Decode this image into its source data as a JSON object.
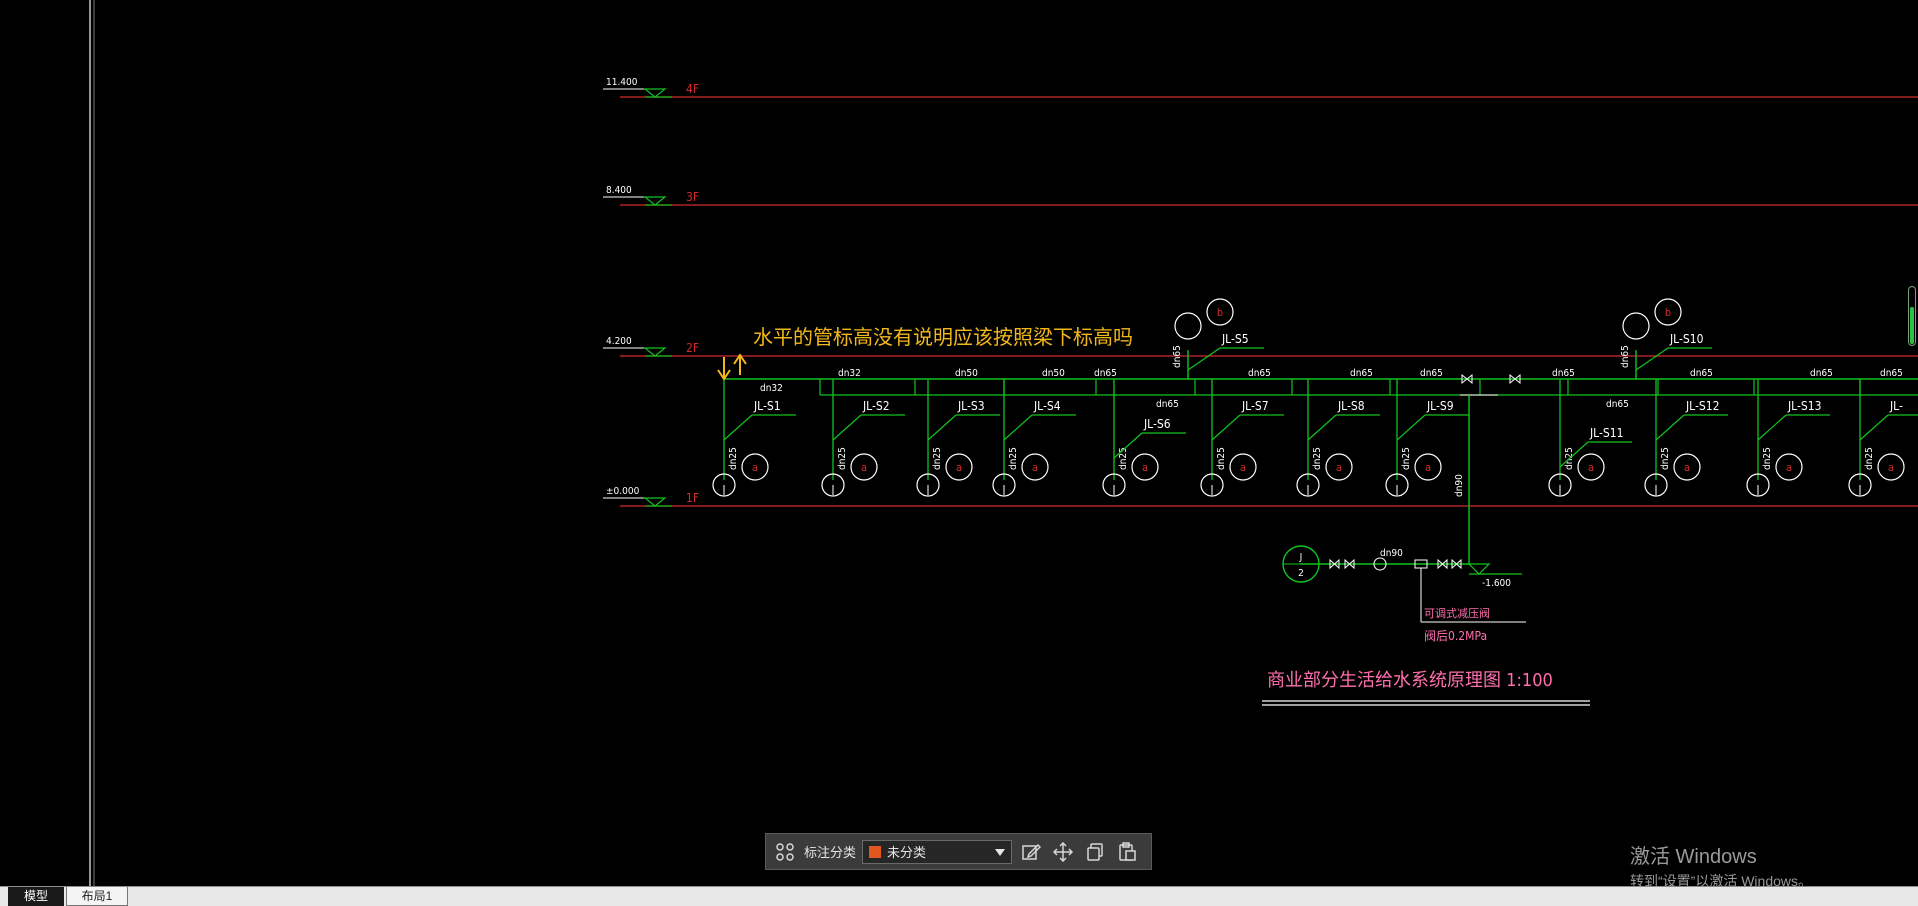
{
  "drawing": {
    "floors": [
      {
        "elevation": "11.400",
        "label": "4F"
      },
      {
        "elevation": "8.400",
        "label": "3F"
      },
      {
        "elevation": "4.200",
        "label": "2F"
      },
      {
        "elevation": "±0.000",
        "label": "1F"
      }
    ],
    "annotation": "水平的管标高没有说明应该按照梁下标高吗",
    "risers": [
      "JL-S1",
      "JL-S2",
      "JL-S3",
      "JL-S4",
      "JL-S5",
      "JL-S6",
      "JL-S7",
      "JL-S8",
      "JL-S9",
      "JL-S10",
      "JL-S11",
      "JL-S12",
      "JL-S13",
      "JL-"
    ],
    "pipe_sizes": {
      "dn32": "dn32",
      "dn50": "dn50",
      "dn65": "dn65",
      "dn25": "dn25",
      "dn90": "dn90"
    },
    "circle_labels": {
      "a": "a",
      "b": "b",
      "j": "J",
      "j_num": "2"
    },
    "inlet_elevation": "-1.600",
    "valve_note_1": "可调式减压阀",
    "valve_note_2": "阀后0.2MPa",
    "title": "商业部分生活给水系统原理图 1:100"
  },
  "toolbar": {
    "category_label": "标注分类",
    "category_value": "未分类",
    "category_color": "#e2571e"
  },
  "tabs": {
    "model": "模型",
    "layout1": "布局1"
  },
  "activation": {
    "title": "激活 Windows",
    "subtitle": "转到“设置”以激活 Windows。"
  },
  "colors": {
    "red_line": "#d22a2a",
    "green_pipe": "#11c41f",
    "white": "#ffffff",
    "annotation": "#f2b81a",
    "title": "#ff6fae"
  }
}
